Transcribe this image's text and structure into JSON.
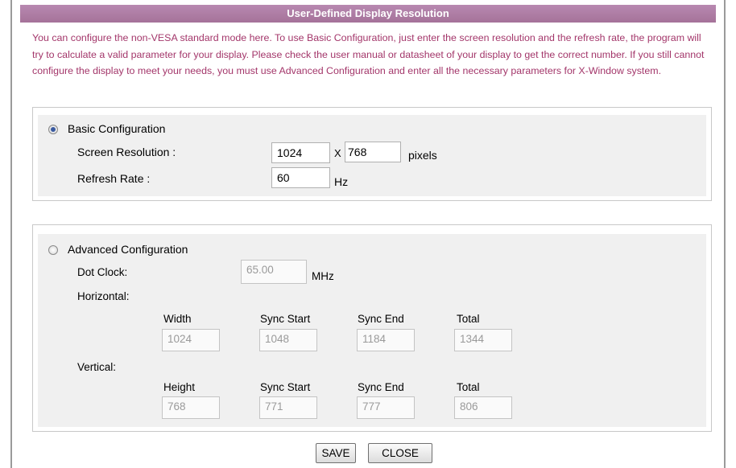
{
  "dialog": {
    "title": "User-Defined Display Resolution"
  },
  "intro": "You can configure the non-VESA standard mode here. To use Basic Configuration, just enter the screen resolution and the refresh rate, the program will try to calculate a valid parameter for your display. Please check the user manual or datasheet of your display to get the correct number. If you still cannot configure the display to meet your needs, you must use Advanced Configuration and enter all the necessary parameters for X-Window system.",
  "basic": {
    "label": "Basic Configuration",
    "selected": true,
    "screen_resolution_label": "Screen Resolution :",
    "width": "1024",
    "x_separator": "X",
    "height": "768",
    "pixels_unit": "pixels",
    "refresh_rate_label": "Refresh Rate :",
    "refresh_rate": "60",
    "hz_unit": "Hz"
  },
  "advanced": {
    "label": "Advanced Configuration",
    "selected": false,
    "dot_clock_label": "Dot Clock:",
    "dot_clock": "65.00",
    "mhz_unit": "MHz",
    "horizontal_label": "Horizontal:",
    "horizontal": {
      "headers": [
        "Width",
        "Sync Start",
        "Sync End",
        "Total"
      ],
      "values": [
        "1024",
        "1048",
        "1184",
        "1344"
      ]
    },
    "vertical_label": "Vertical:",
    "vertical": {
      "headers": [
        "Height",
        "Sync Start",
        "Sync End",
        "Total"
      ],
      "values": [
        "768",
        "771",
        "777",
        "806"
      ]
    }
  },
  "buttons": {
    "save": "SAVE",
    "close": "CLOSE"
  }
}
